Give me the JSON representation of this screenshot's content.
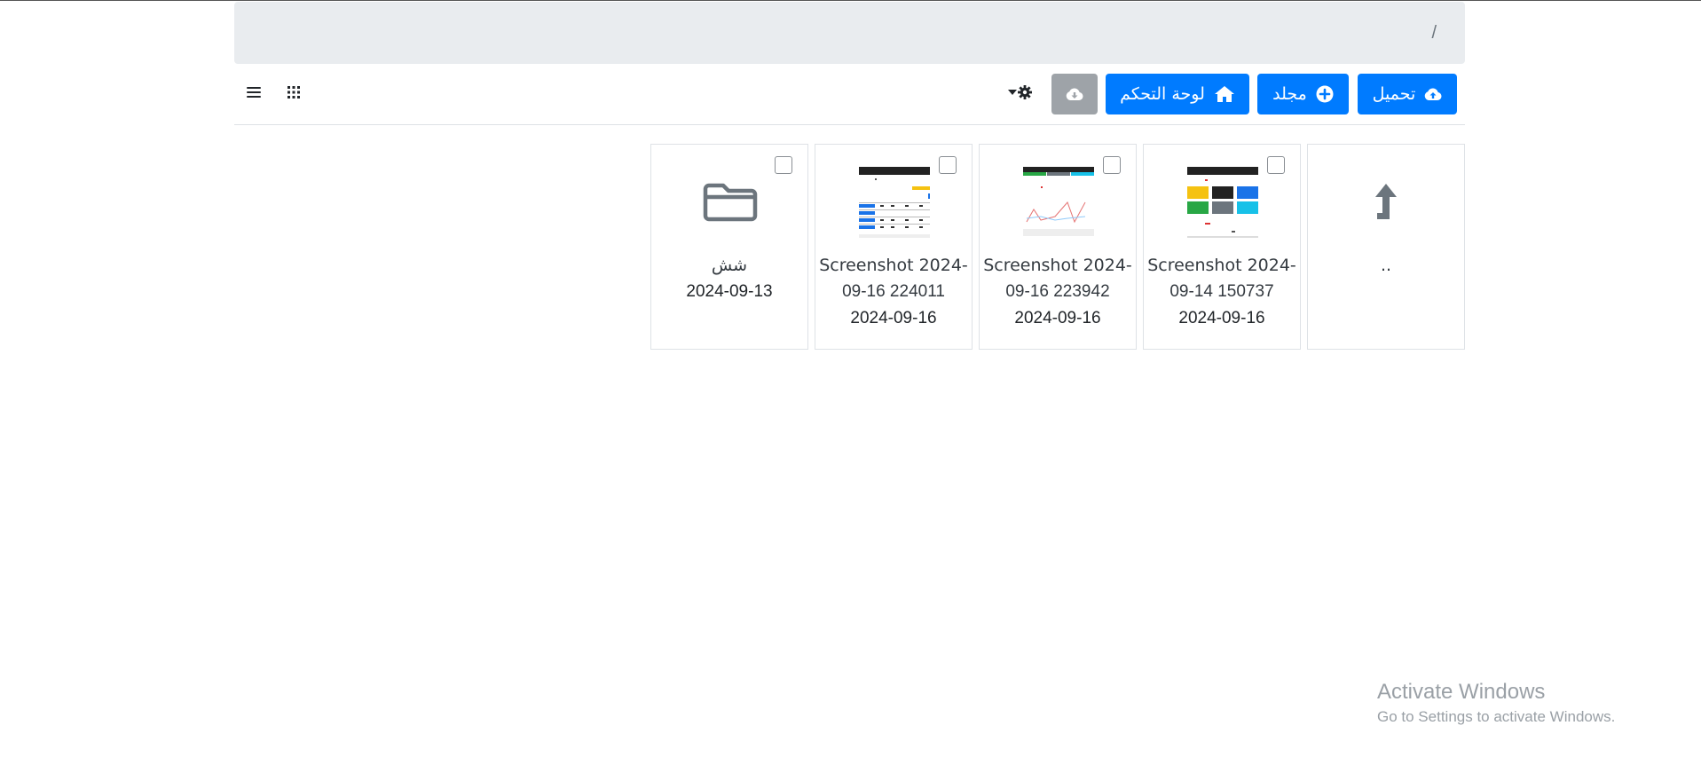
{
  "breadcrumb": {
    "root": "/"
  },
  "toolbar": {
    "upload_label": "تحميل",
    "folder_label": "مجلد",
    "dashboard_label": "لوحة التحكم"
  },
  "items": [
    {
      "kind": "up",
      "name": "..",
      "date": ""
    },
    {
      "kind": "image",
      "name_line1": "Screenshot 2024-",
      "name_line2": "09-14 150737",
      "date": "2024-09-16"
    },
    {
      "kind": "image",
      "name_line1": "Screenshot 2024-",
      "name_line2": "09-16 223942",
      "date": "2024-09-16"
    },
    {
      "kind": "image",
      "name_line1": "Screenshot 2024-",
      "name_line2": "09-16 224011",
      "date": "2024-09-16"
    },
    {
      "kind": "folder",
      "name": "شش",
      "date": "2024-09-13"
    }
  ],
  "watermark": {
    "title": "Activate Windows",
    "subtitle": "Go to Settings to activate Windows."
  },
  "colors": {
    "primary": "#007bff",
    "secondary": "#9ea3a8",
    "breadcrumb_bg": "#e9ecef"
  }
}
